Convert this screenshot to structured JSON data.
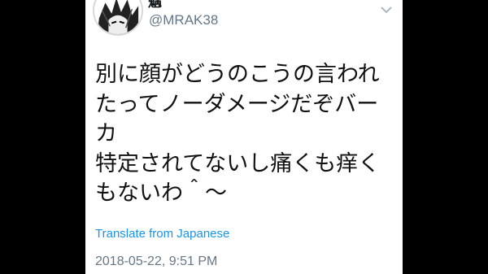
{
  "tweet": {
    "display_name": "魑",
    "handle": "@MRAK38",
    "avatar_icon": "manga-avatar-icon",
    "menu_icon": "chevron-down-icon",
    "lines": [
      "別に顔がどうのこうの言われ",
      "たってノーダメージだぞバー",
      "カ",
      "特定されてないし痛くも痒く",
      "もないわ＾〜"
    ],
    "translate_label": "Translate from Japanese",
    "timestamp": "2018-05-22, 9:51 PM"
  },
  "colors": {
    "background": "#000000",
    "card": "#ffffff",
    "link": "#1b95e0",
    "muted": "#657786"
  }
}
